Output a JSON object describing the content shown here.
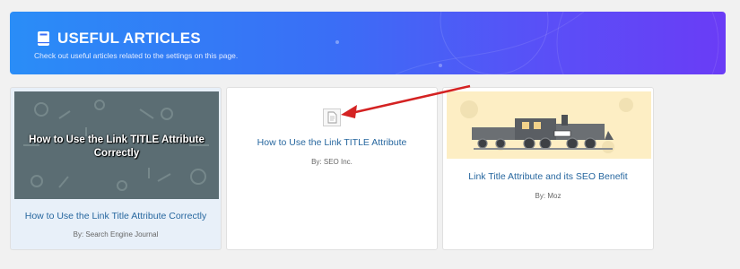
{
  "header": {
    "title": "USEFUL ARTICLES",
    "subtitle": "Check out useful articles related to the settings on this page.",
    "icon": "book-icon"
  },
  "articles": [
    {
      "thumbnail_text": "How to Use the Link TITLE Attribute Correctly",
      "title": "How to Use the Link Title Attribute Correctly",
      "byline": "By: Search Engine Journal"
    },
    {
      "thumbnail_icon": "document-icon",
      "title": "How to Use the Link TITLE Attribute",
      "byline": "By: SEO Inc."
    },
    {
      "thumbnail_icon": "train-illustration",
      "title": "Link Title Attribute and its SEO Benefit",
      "byline": "By: Moz"
    }
  ],
  "colors": {
    "link": "#27679f",
    "banner_start": "#2a8df7",
    "banner_end": "#6a3cf6",
    "annotation_arrow": "#d42222"
  }
}
